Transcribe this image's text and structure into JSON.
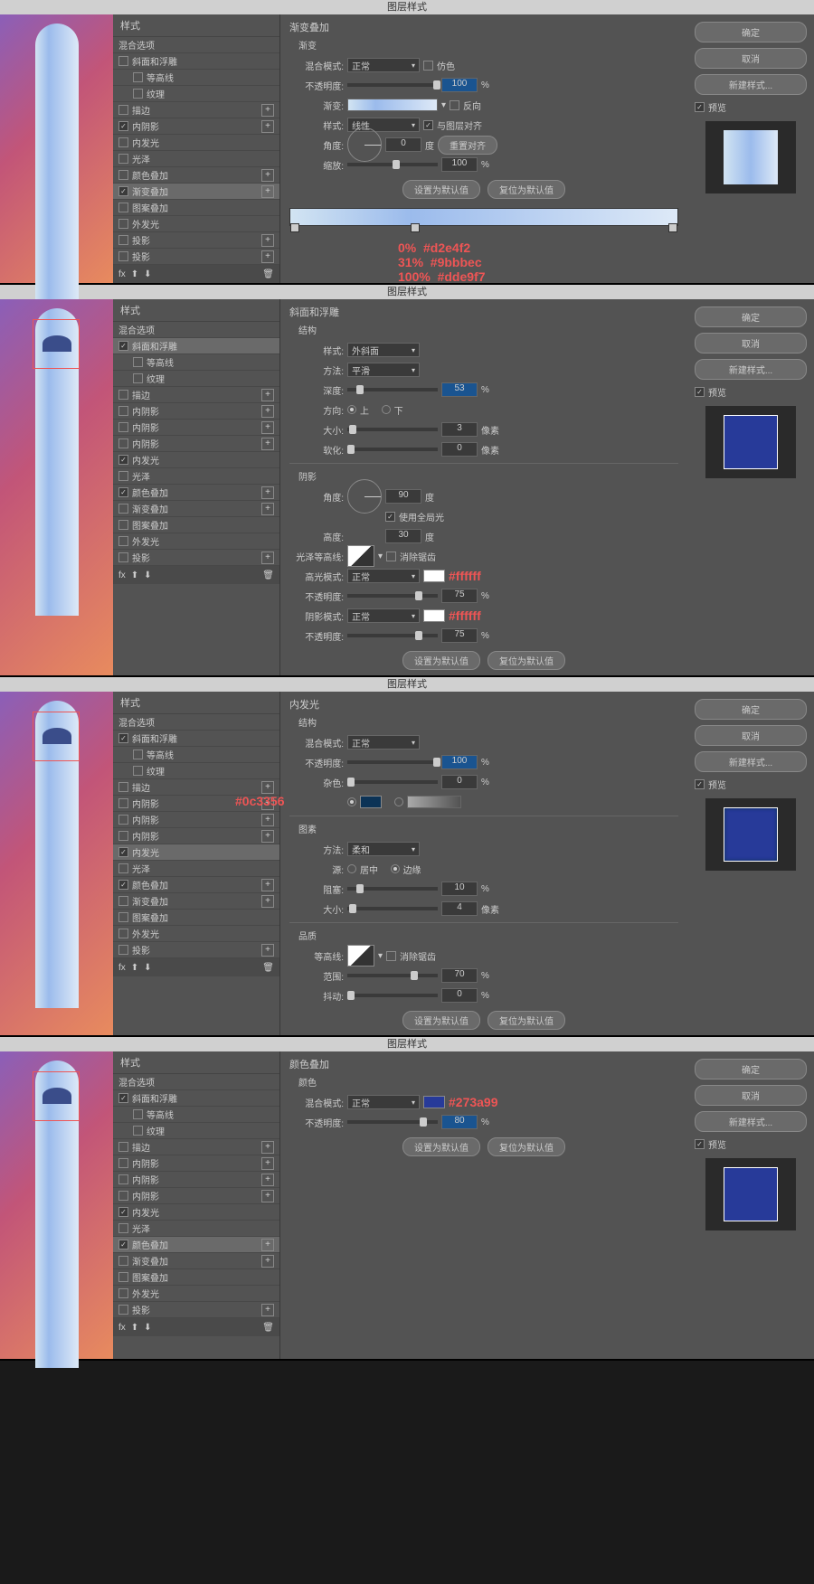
{
  "dialogTitle": "图层样式",
  "styleHeader": "样式",
  "blendOptions": "混合选项",
  "effects": {
    "bevel": "斜面和浮雕",
    "contour": "等高线",
    "texture": "纹理",
    "stroke": "描边",
    "innerShadow": "内阴影",
    "innerShadow2": "内阴影",
    "innerShadow3": "内阴影",
    "innerGlow": "内发光",
    "satin": "光泽",
    "colorOverlay": "颜色叠加",
    "gradOverlay": "渐变叠加",
    "patternOverlay": "图案叠加",
    "outerGlow": "外发光",
    "dropShadow": "投影",
    "dropShadow2": "投影"
  },
  "buttons": {
    "ok": "确定",
    "cancel": "取消",
    "newStyle": "新建样式...",
    "preview": "预览",
    "setDefault": "设置为默认值",
    "resetDefault": "复位为默认值",
    "resetAlign": "重置对齐"
  },
  "panel1": {
    "title": "渐变叠加",
    "subtitle": "渐变",
    "blendMode": "混合模式:",
    "blendModeVal": "正常",
    "dither": "仿色",
    "opacity": "不透明度:",
    "opacityVal": "100",
    "gradient": "渐变:",
    "reverse": "反向",
    "style": "样式:",
    "styleVal": "线性",
    "alignLayer": "与图层对齐",
    "angle": "角度:",
    "angleVal": "0",
    "degree": "度",
    "scale": "缩放:",
    "scaleVal": "100",
    "stops": "0%  #d2e4f2\n31%  #9bbbec\n100%  #dde9f7"
  },
  "panel2": {
    "title": "斜面和浮雕",
    "struct": "结构",
    "style": "样式:",
    "styleVal": "外斜面",
    "technique": "方法:",
    "techVal": "平滑",
    "depth": "深度:",
    "depthVal": "53",
    "direction": "方向:",
    "up": "上",
    "down": "下",
    "size": "大小:",
    "sizeVal": "3",
    "soften": "软化:",
    "softenVal": "0",
    "px": "像素",
    "shading": "阴影",
    "angle": "角度:",
    "angleVal": "90",
    "degree": "度",
    "globalLight": "使用全局光",
    "altitude": "高度:",
    "altVal": "30",
    "glossContour": "光泽等高线:",
    "antiAlias": "消除锯齿",
    "highlightMode": "高光模式:",
    "hmVal": "正常",
    "hlOpacity": "不透明度:",
    "hlOpVal": "75",
    "shadowMode": "阴影模式:",
    "smVal": "正常",
    "shOpacity": "不透明度:",
    "shOpVal": "75",
    "colorAnno": "#ffffff"
  },
  "panel3": {
    "title": "内发光",
    "struct": "结构",
    "blendMode": "混合模式:",
    "bmVal": "正常",
    "opacity": "不透明度:",
    "opVal": "100",
    "noise": "杂色:",
    "noiseVal": "0",
    "colorAnno": "#0c3356",
    "elements": "图素",
    "technique": "方法:",
    "techVal": "柔和",
    "source": "源:",
    "center": "居中",
    "edge": "边缘",
    "choke": "阻塞:",
    "chokeVal": "10",
    "size": "大小:",
    "sizeVal": "4",
    "px": "像素",
    "quality": "品质",
    "contour": "等高线:",
    "antiAlias": "消除锯齿",
    "range": "范围:",
    "rangeVal": "70",
    "jitter": "抖动:",
    "jitterVal": "0"
  },
  "panel4": {
    "title": "颜色叠加",
    "subtitle": "颜色",
    "blendMode": "混合模式:",
    "bmVal": "正常",
    "opacity": "不透明度:",
    "opVal": "80",
    "colorAnno": "#273a99"
  },
  "pct": "%",
  "fx": "fx"
}
